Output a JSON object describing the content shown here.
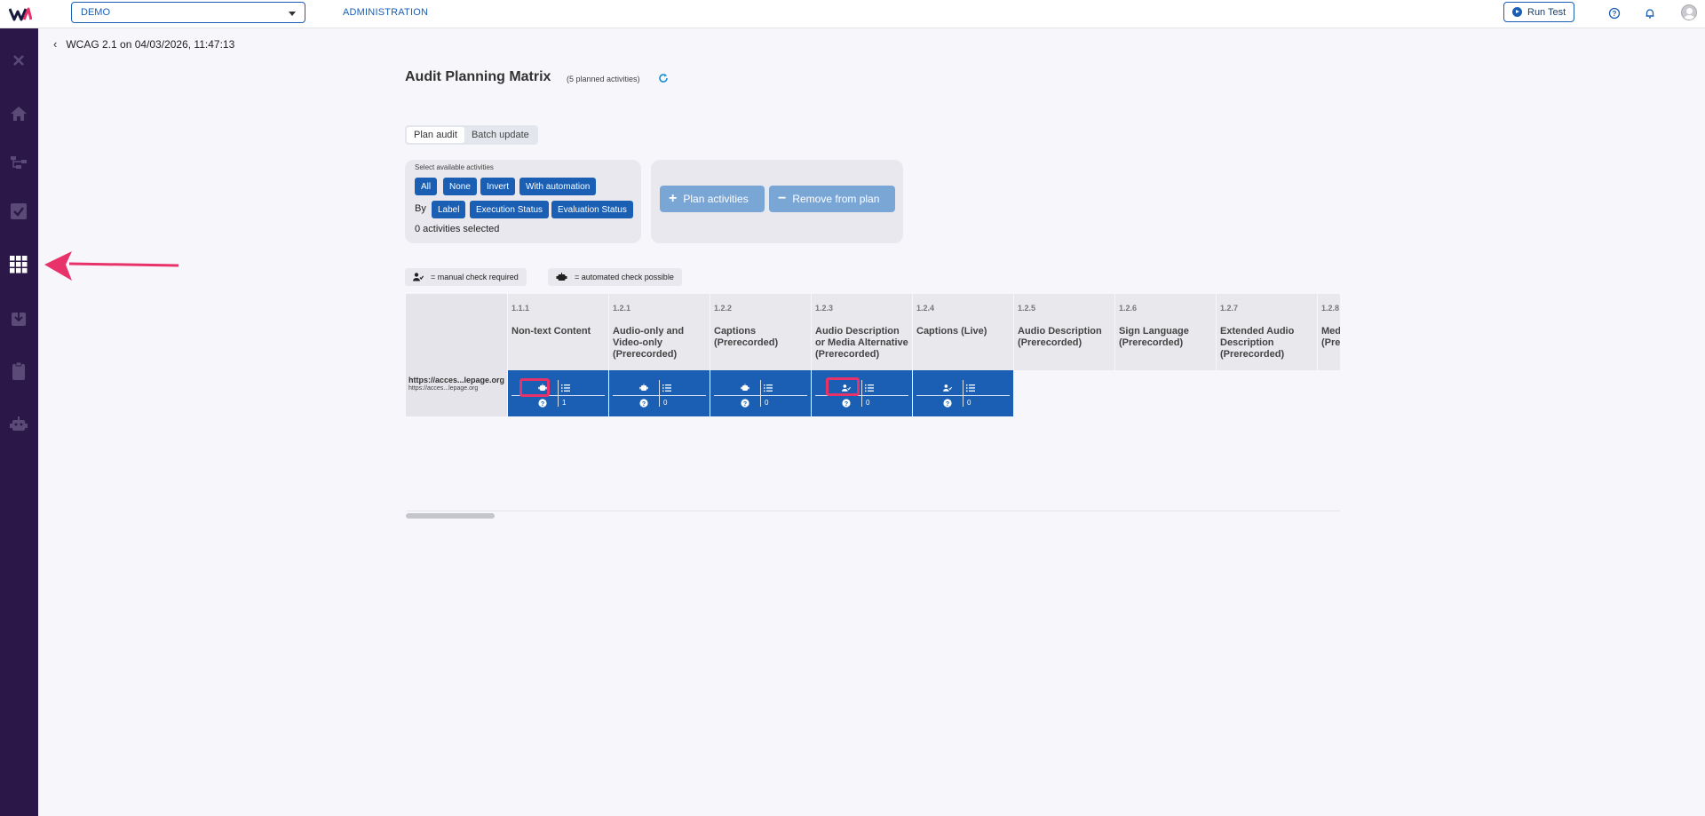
{
  "topbar": {
    "project": "DEMO",
    "admin_link": "ADMINISTRATION",
    "run_test": "Run Test"
  },
  "breadcrumb": {
    "title": "WCAG 2.1 on 04/03/2026, 11:47:13"
  },
  "header": {
    "title": "Audit Planning Matrix",
    "planned_count": "(5 planned activities)"
  },
  "tabs": [
    {
      "label": "Plan audit",
      "active": true
    },
    {
      "label": "Batch update",
      "active": false
    }
  ],
  "select_panel": {
    "label": "Select available activities",
    "buttons": [
      "All",
      "None",
      "Invert",
      "With automation"
    ],
    "by_label": "By",
    "by_buttons": [
      "Label",
      "Execution Status",
      "Evaluation Status"
    ],
    "selected_count": "0 activities selected"
  },
  "actions": {
    "plan": "Plan activities",
    "remove": "Remove from plan"
  },
  "legend": {
    "manual": "= manual check required",
    "automated": "= automated check possible"
  },
  "matrix": {
    "columns": [
      {
        "num": "1.1.1",
        "name": "Non-text Content"
      },
      {
        "num": "1.2.1",
        "name": "Audio-only and Video-only (Prerecorded)"
      },
      {
        "num": "1.2.2",
        "name": "Captions (Prerecorded)"
      },
      {
        "num": "1.2.3",
        "name": "Audio Description or Media Alternative (Prerecorded)"
      },
      {
        "num": "1.2.4",
        "name": "Captions (Live)"
      },
      {
        "num": "1.2.5",
        "name": "Audio Description (Prerecorded)"
      },
      {
        "num": "1.2.6",
        "name": "Sign Language (Prerecorded)"
      },
      {
        "num": "1.2.7",
        "name": "Extended Audio Description (Prerecorded)"
      },
      {
        "num": "1.2.8",
        "name": "Media Alternative (Prerecorded)"
      }
    ],
    "row": {
      "url_main": "https://acces...lepage.org",
      "url_sub": "https://acces...lepage.org"
    },
    "cells": [
      {
        "type": "automated",
        "count": "1"
      },
      {
        "type": "automated",
        "count": "0"
      },
      {
        "type": "automated",
        "count": "0"
      },
      {
        "type": "manual",
        "count": "0"
      },
      {
        "type": "manual",
        "count": "0"
      }
    ]
  },
  "colors": {
    "sidebar": "#2b1848",
    "primary": "#1a5fb4",
    "highlight": "#e8336a"
  }
}
